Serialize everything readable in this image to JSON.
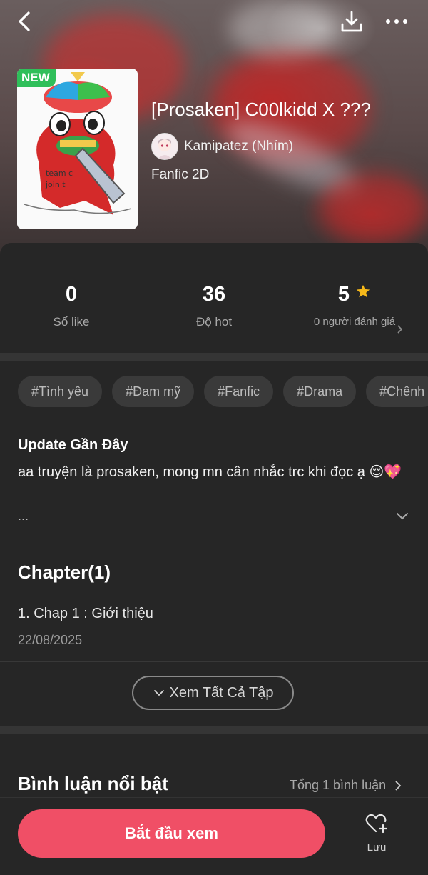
{
  "header": {
    "back_icon": "chevron-left-icon",
    "download_icon": "download-icon",
    "more_icon": "more-horizontal-icon"
  },
  "story": {
    "badge": "NEW",
    "title": "[Prosaken] C00lkidd X ???",
    "author": "Kamipatez (Nhím)",
    "genre": "Fanfic 2D"
  },
  "stats": {
    "likes": {
      "value": "0",
      "label": "Số like"
    },
    "hot": {
      "value": "36",
      "label": "Độ hot"
    },
    "rating": {
      "value": "5",
      "label": "0 người đánh giá",
      "icon": "star-icon",
      "color": "#f5b81a"
    }
  },
  "tags": [
    "#Tình yêu",
    "#Đam mỹ",
    "#Fanfic",
    "#Drama",
    "#Chênh"
  ],
  "update": {
    "title": "Update Gần Đây",
    "text": "aa truyện là prosaken, mong mn cân nhắc trc khi đọc ạ 😌💖",
    "more": "..."
  },
  "chapters": {
    "heading": "Chapter(1)",
    "items": [
      {
        "title": "1. Chap 1 : Giới thiệu",
        "date": "22/08/2025"
      }
    ],
    "view_all": "Xem Tất Cả Tập"
  },
  "comments": {
    "heading": "Bình luận nổi bật",
    "total": "Tổng 1 bình luận"
  },
  "bottom": {
    "start": "Bắt đầu xem",
    "save": "Lưu",
    "accent": "#f04f66"
  }
}
